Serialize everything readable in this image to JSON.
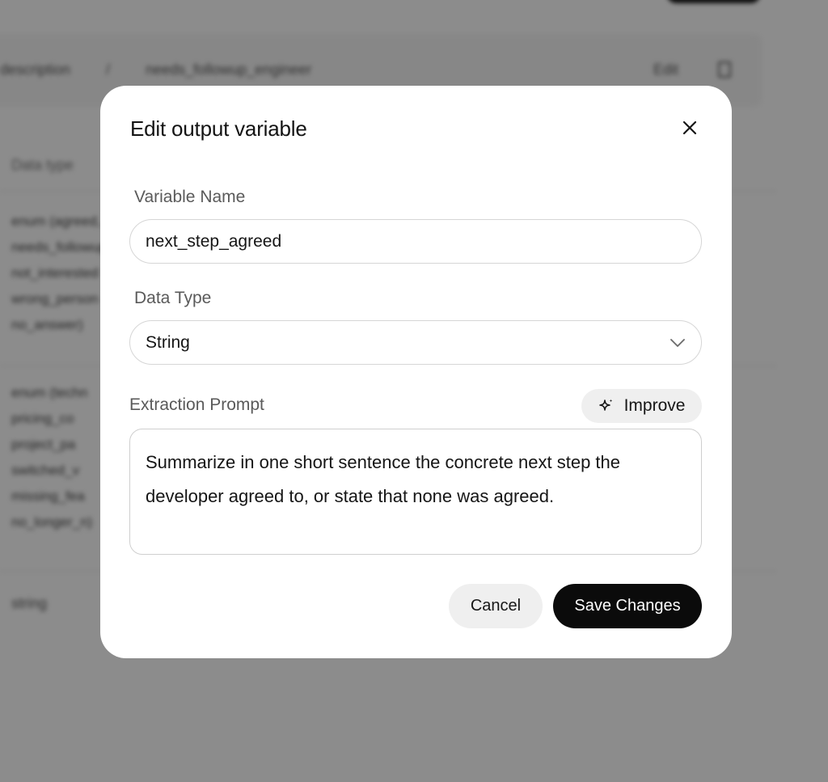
{
  "background": {
    "breadcrumb": [
      "description",
      "/",
      "needs_followup_engineer"
    ],
    "edit_label": "Edit",
    "section_label": "Data type",
    "block1": "enum (agreed,\nneeds_followup\nnot_interested\nwrong_person\nno_answer)",
    "block2": "enum (techn\npricing_co\nproject_pa\nswitched_v\nmissing_fea\nno_longer_n)",
    "string_label": "string"
  },
  "modal": {
    "title": "Edit output variable",
    "variable_name": {
      "label": "Variable Name",
      "value": "next_step_agreed"
    },
    "data_type": {
      "label": "Data Type",
      "selected": "String"
    },
    "extraction_prompt": {
      "label": "Extraction Prompt",
      "improve_label": "Improve",
      "value": "Summarize in one short sentence the concrete next step the developer agreed to, or state that none was agreed."
    },
    "actions": {
      "cancel_label": "Cancel",
      "save_label": "Save Changes"
    }
  },
  "colors": {
    "overlay": "rgba(0,0,0,0.45)",
    "primary_button": "#0b0b0b",
    "secondary_button": "#efefef",
    "border": "#d6d6d6"
  },
  "icons": {
    "close": "close-icon",
    "chevron": "chevron-down-icon",
    "improve": "sparkle-icon"
  }
}
